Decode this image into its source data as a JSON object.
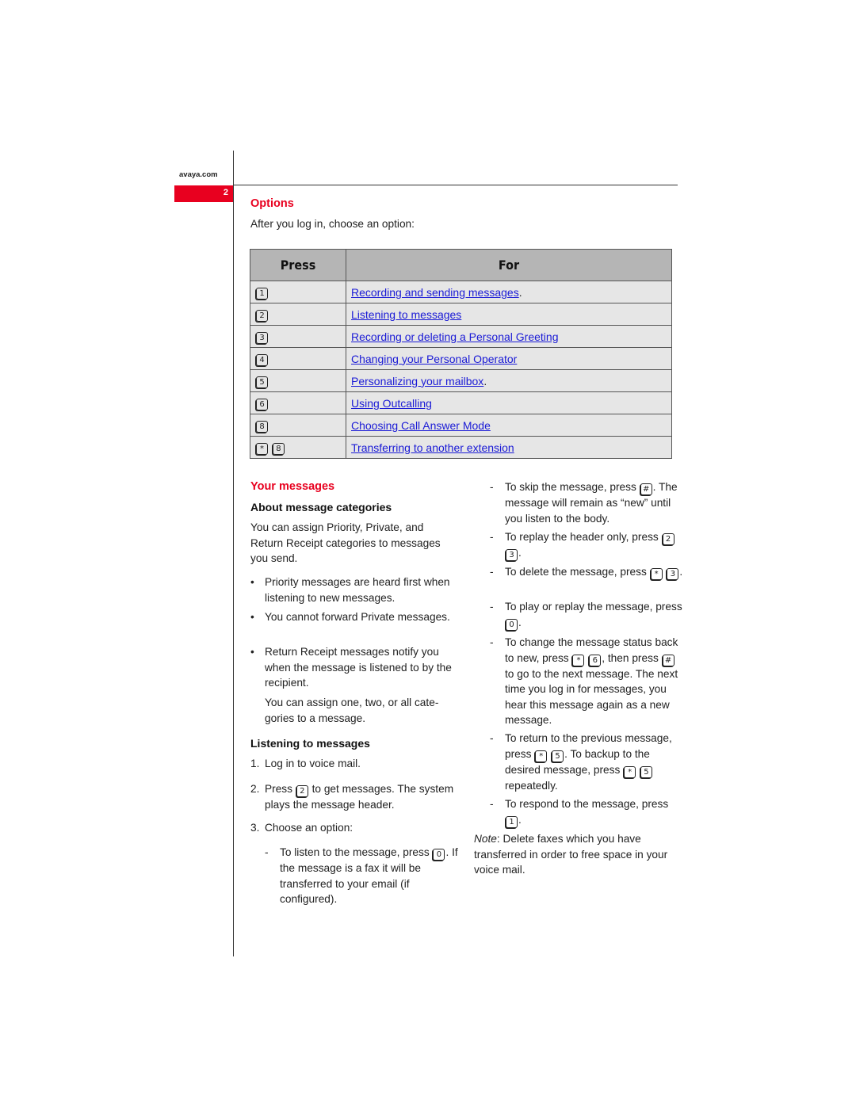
{
  "header": {
    "site": "avaya.com",
    "page_number": "2",
    "accent_color": "#e8001f"
  },
  "options": {
    "title": "Options",
    "intro": "After you log in, choose an option:",
    "table": {
      "headers": [
        "Press",
        "For"
      ],
      "rows": [
        {
          "keys": [
            "1"
          ],
          "link": "Recording and sending messages",
          "suffix": "."
        },
        {
          "keys": [
            "2"
          ],
          "link": "Listening to messages",
          "suffix": ""
        },
        {
          "keys": [
            "3"
          ],
          "link": "Recording or deleting a Personal Greeting",
          "suffix": ""
        },
        {
          "keys": [
            "4"
          ],
          "link": "Changing your Personal Operator",
          "suffix": ""
        },
        {
          "keys": [
            "5"
          ],
          "link": "Personalizing your mailbox",
          "suffix": "."
        },
        {
          "keys": [
            "6"
          ],
          "link": "Using Outcalling",
          "suffix": ""
        },
        {
          "keys": [
            "8"
          ],
          "link": "Choosing Call Answer Mode",
          "suffix": ""
        },
        {
          "keys": [
            "*",
            "8"
          ],
          "link": "Transferring to another extension",
          "suffix": ""
        }
      ]
    }
  },
  "your_messages": {
    "title": "Your messages",
    "categories": {
      "heading": "About message categories",
      "intro": "You can assign Priority, Private, and Return Receipt categories to messages you send.",
      "bullets": [
        "Priority messages are heard first when listening to new messages.",
        "You cannot forward Private messages.",
        "Return Receipt messages notify you when the message is listened to by the recipient."
      ],
      "note": "You can assign one, two, or all cate-gories to a message."
    },
    "listening": {
      "heading": "Listening to messages",
      "steps": [
        {
          "num": "1.",
          "text": "Log in to voice mail."
        },
        {
          "num": "2.",
          "pre": "Press",
          "keys": [
            "2"
          ],
          "post": "to get messages. The system plays the message header."
        },
        {
          "num": "3.",
          "text": "Choose an option:"
        }
      ],
      "options": [
        {
          "pre": "To listen to the message, press",
          "keys": [
            "0"
          ],
          "post": ". If the message is a fax it will be transferred to your email (if configured)."
        },
        {
          "pre": "To skip the message, press",
          "keys": [
            "#"
          ],
          "post": ". The message will remain as “new” until you listen to the body."
        },
        {
          "pre": "To replay the header only, press",
          "keys": [
            "2",
            "3"
          ],
          "post": "."
        },
        {
          "pre": "To delete the message, press",
          "keys": [
            "*",
            "3"
          ],
          "post": "."
        },
        {
          "pre": "To play or replay the message, press",
          "keys": [
            "0"
          ],
          "post": "."
        },
        {
          "pre": "To change the message status back to new, press",
          "keys": [
            "*",
            "6"
          ],
          "mid": ", then press",
          "keys2": [
            "#"
          ],
          "post": "to go to the next message. The next time you log in for messages, you hear this message again as a new message."
        },
        {
          "pre": "To return to the previous message, press",
          "keys": [
            "*",
            "5"
          ],
          "mid": ". To backup to the desired message, press",
          "keys2": [
            "*",
            "5"
          ],
          "post": "repeatedly."
        },
        {
          "pre": "To respond to the message, press",
          "keys": [
            "1"
          ],
          "post": "."
        }
      ],
      "note_label": "Note",
      "note_text": ": Delete faxes which you have transferred in order to free space in your voice mail."
    }
  }
}
